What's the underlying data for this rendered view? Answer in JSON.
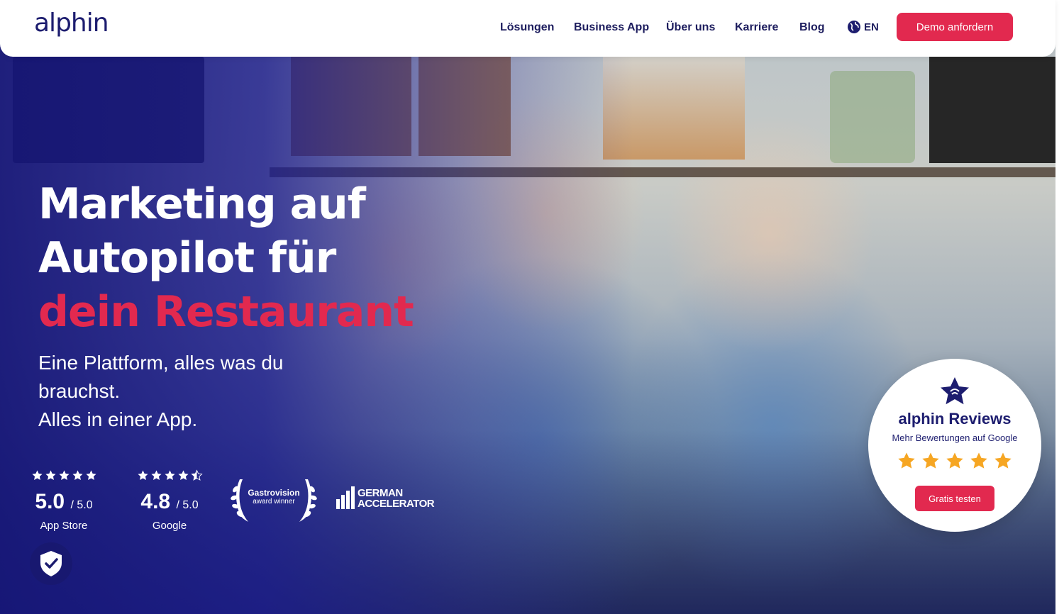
{
  "brand": {
    "logo_text": "alphin",
    "accent_color": "#e2294f",
    "primary_color": "#1d1d6f"
  },
  "nav": {
    "links": [
      "Lösungen",
      "Business App",
      "Über uns",
      "Karriere",
      "Blog"
    ],
    "language": "EN",
    "language_icon": "globe-icon",
    "cta_label": "Demo anfordern"
  },
  "hero": {
    "headline_line1": "Marketing auf",
    "headline_line2": "Autopilot für",
    "headline_accent": "dein Restaurant",
    "subline1": "Eine Plattform, alles was du brauchst.",
    "subline2": "Alles in einer App."
  },
  "ratings": [
    {
      "score": "5.0",
      "max": "/ 5.0",
      "source": "App Store",
      "stars": 5
    },
    {
      "score": "4.8",
      "max": "/ 5.0",
      "source": "Google",
      "stars": 4.8
    }
  ],
  "awards": {
    "gastrovision_title": "Gastrovision",
    "gastrovision_sub": "award winner",
    "german_accelerator_line1": "GERMAN",
    "german_accelerator_line2": "ACCELERATOR"
  },
  "review_badge": {
    "title": "alphin Reviews",
    "subtitle": "Mehr Bewertungen auf Google",
    "stars": 5,
    "button_label": "Gratis testen",
    "star_color": "#f6a623"
  },
  "security_icon": "shield-check-icon"
}
